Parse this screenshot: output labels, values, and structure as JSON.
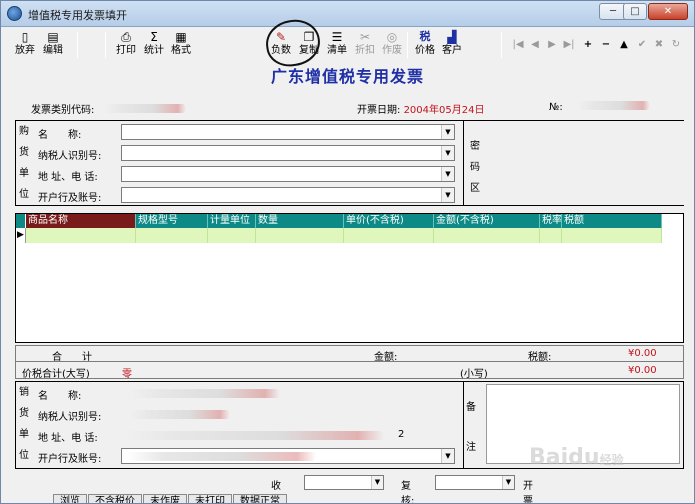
{
  "window": {
    "title": "增值税专用发票填开",
    "controls": [
      "─",
      "□",
      "✕"
    ]
  },
  "toolbar": {
    "left": [
      {
        "id": "giveup",
        "label": "放弃",
        "icon": "exit-icon"
      },
      {
        "id": "edit",
        "label": "编辑",
        "icon": "edit-icon"
      },
      {
        "id": "print",
        "label": "打印",
        "icon": "printer-icon"
      },
      {
        "id": "stats",
        "label": "统计",
        "icon": "sigma-icon"
      },
      {
        "id": "format",
        "label": "格式",
        "icon": "format-icon"
      }
    ],
    "middle": [
      {
        "id": "negative",
        "label": "负数",
        "icon": "pen-icon",
        "enabled": true
      },
      {
        "id": "copy",
        "label": "复制",
        "icon": "copy-icon",
        "enabled": true
      },
      {
        "id": "list",
        "label": "清单",
        "icon": "list-icon",
        "enabled": true
      },
      {
        "id": "discount",
        "label": "折扣",
        "icon": "discount-icon",
        "enabled": false
      },
      {
        "id": "void",
        "label": "作废",
        "icon": "void-icon",
        "enabled": false
      },
      {
        "id": "price",
        "label": "价格",
        "icon": "tax-icon",
        "enabled": true
      },
      {
        "id": "customer",
        "label": "客户",
        "icon": "customer-icon",
        "enabled": true
      }
    ],
    "nav": [
      "|◀",
      "◀",
      "▶",
      "▶|",
      "+",
      "−",
      "▲",
      "✔",
      "✖",
      "↻"
    ]
  },
  "invoice": {
    "title": "广东增值税专用发票",
    "code_label": "发票类别代码:",
    "date_label": "开票日期:",
    "date_value": "2004年05月24日",
    "no_label": "№:"
  },
  "buyer": {
    "side_chars": [
      "购",
      "货",
      "单",
      "位"
    ],
    "fields": [
      {
        "label": "名　　称:",
        "value": ""
      },
      {
        "label": "纳税人识别号:",
        "value": ""
      },
      {
        "label": "地 址、电 话:",
        "value": ""
      },
      {
        "label": "开户行及账号:",
        "value": ""
      }
    ],
    "password_chars": [
      "密",
      "码",
      "区"
    ]
  },
  "goods": {
    "columns": [
      {
        "label": "商品名称",
        "w": 110
      },
      {
        "label": "规格型号",
        "w": 72
      },
      {
        "label": "计量单位",
        "w": 48
      },
      {
        "label": "数量",
        "w": 88
      },
      {
        "label": "单价(不含税)",
        "w": 90
      },
      {
        "label": "金额(不含税)",
        "w": 106
      },
      {
        "label": "税率",
        "w": 22
      },
      {
        "label": "税额",
        "w": 100
      }
    ],
    "row_marker": "▶"
  },
  "totals": {
    "heji_label": "合　　计",
    "amount_label": "金额:",
    "tax_label": "税额:",
    "tax_value": "¥0.00",
    "total_label": "价税合计(大写)",
    "total_upper": "零",
    "small_label": "(小写)",
    "small_value": "¥0.00"
  },
  "seller": {
    "side_chars": [
      "销",
      "货",
      "单",
      "位"
    ],
    "fields": [
      {
        "label": "名　　称:"
      },
      {
        "label": "纳税人识别号:"
      },
      {
        "label": "地 址、电 话:"
      },
      {
        "label": "开户行及账号:"
      }
    ],
    "phone_suffix": "2",
    "note_chars": [
      "备",
      "注"
    ]
  },
  "footer": {
    "payee_label": "收款:",
    "reviewer_label": "复核:",
    "drawer_label": "开票"
  },
  "tabs": [
    "浏览",
    "不含税价",
    "未作废",
    "未打印",
    "数据正常"
  ],
  "watermark": {
    "text": "Baidu",
    "suffix": "经验"
  }
}
